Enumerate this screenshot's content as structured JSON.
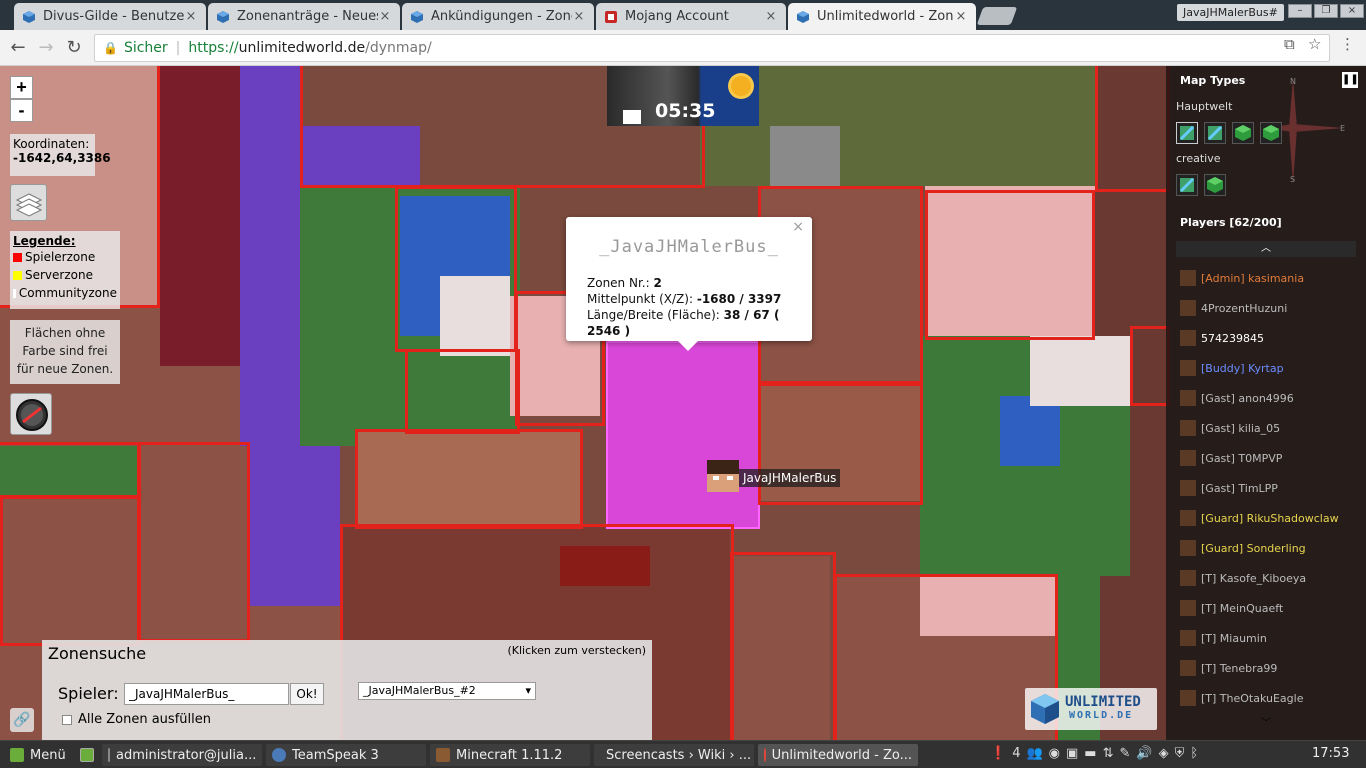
{
  "browser": {
    "tabs": [
      {
        "title": "Divus-Gilde - Benutzer",
        "color": "#2f6fb3"
      },
      {
        "title": "Zonenanträge - Neues T",
        "color": "#2f6fb3"
      },
      {
        "title": "Ankündigungen - Zonen",
        "color": "#2f6fb3"
      },
      {
        "title": "Mojang Account",
        "color": "#c62828"
      },
      {
        "title": "Unlimitedworld - Zonen",
        "color": "#2f6fb3"
      }
    ],
    "profile_name": "JavaJHMalerBus#",
    "secure_label": "Sicher",
    "url_scheme": "https://",
    "url_host": "unlimitedworld.de",
    "url_path": "/dynmap/"
  },
  "map": {
    "zoom_in": "+",
    "zoom_out": "-",
    "coords_label": "Koordinaten:",
    "coords_value": "-1642,64,3386",
    "legend": {
      "title": "Legende:",
      "items": [
        {
          "label": "Spielerzone",
          "color": "#ff0000"
        },
        {
          "label": "Serverzone",
          "color": "#ffff00"
        },
        {
          "label": "Communityzone",
          "color": "#ffffff"
        }
      ]
    },
    "free_note_lines": [
      "Flächen ohne",
      "Farbe sind frei",
      "für neue Zonen."
    ],
    "clock_time": "05:35",
    "popup": {
      "close": "×",
      "name": "_JavaJHMalerBus_",
      "zone_label": "Zonen Nr.:",
      "zone_value": "2",
      "center_label": "Mittelpunkt (X/Z):",
      "center_value": "-1680 / 3397",
      "size_label": "Länge/Breite (Fläche):",
      "size_value": "38 / 67 ( 2546 )"
    },
    "player_marker": "JavaJHMalerBus"
  },
  "sidebar": {
    "map_types_label": "Map Types",
    "compass": {
      "n": "N",
      "e": "E",
      "s": "S"
    },
    "worlds": [
      {
        "name": "Hauptwelt"
      },
      {
        "name": "creative"
      }
    ],
    "players_label": "Players [62/200]",
    "players": [
      {
        "name": "[Admin] kasimania",
        "color": "#e07b39"
      },
      {
        "name": "4ProzentHuzuni",
        "color": "#bbbbbb"
      },
      {
        "name": "574239845",
        "color": "#ffffff"
      },
      {
        "name": "[Buddy] Kyrtap",
        "color": "#6b8cff"
      },
      {
        "name": "[Gast] anon4996",
        "color": "#bbbbbb"
      },
      {
        "name": "[Gast] kilia_05",
        "color": "#bbbbbb"
      },
      {
        "name": "[Gast] T0MPVP",
        "color": "#bbbbbb"
      },
      {
        "name": "[Gast] TimLPP",
        "color": "#bbbbbb"
      },
      {
        "name": "[Guard] RikuShadowclaw",
        "color": "#e8d44d"
      },
      {
        "name": "[Guard] Sonderling",
        "color": "#e8d44d"
      },
      {
        "name": "[T] Kasofe_Kiboeya",
        "color": "#bbbbbb"
      },
      {
        "name": "[T] MeinQuaeft",
        "color": "#bbbbbb"
      },
      {
        "name": "[T] Miaumin",
        "color": "#bbbbbb"
      },
      {
        "name": "[T] Tenebra99",
        "color": "#bbbbbb"
      },
      {
        "name": "[T] TheOtakuEagle",
        "color": "#bbbbbb"
      }
    ],
    "logo_line1": "UNLIMITED",
    "logo_line2": "WORLD.DE"
  },
  "zonesearch": {
    "title": "Zonensuche",
    "hide_hint": "(Klicken zum verstecken)",
    "player_label": "Spieler:",
    "player_value": "_JavaJHMalerBus_",
    "ok_label": "Ok!",
    "select_value": "_JavaJHMalerBus_#2",
    "fill_all_label": "Alle Zonen ausfüllen"
  },
  "taskbar": {
    "menu_label": "Menü",
    "tasks": [
      {
        "label": "administrator@julia...",
        "active": false
      },
      {
        "label": "TeamSpeak 3",
        "active": false
      },
      {
        "label": "Minecraft 1.11.2",
        "active": false
      },
      {
        "label": "Screencasts › Wiki › ...",
        "active": false
      },
      {
        "label": "Unlimitedworld - Zo...",
        "active": true
      }
    ],
    "tray_count": "4",
    "time": "17:53"
  }
}
